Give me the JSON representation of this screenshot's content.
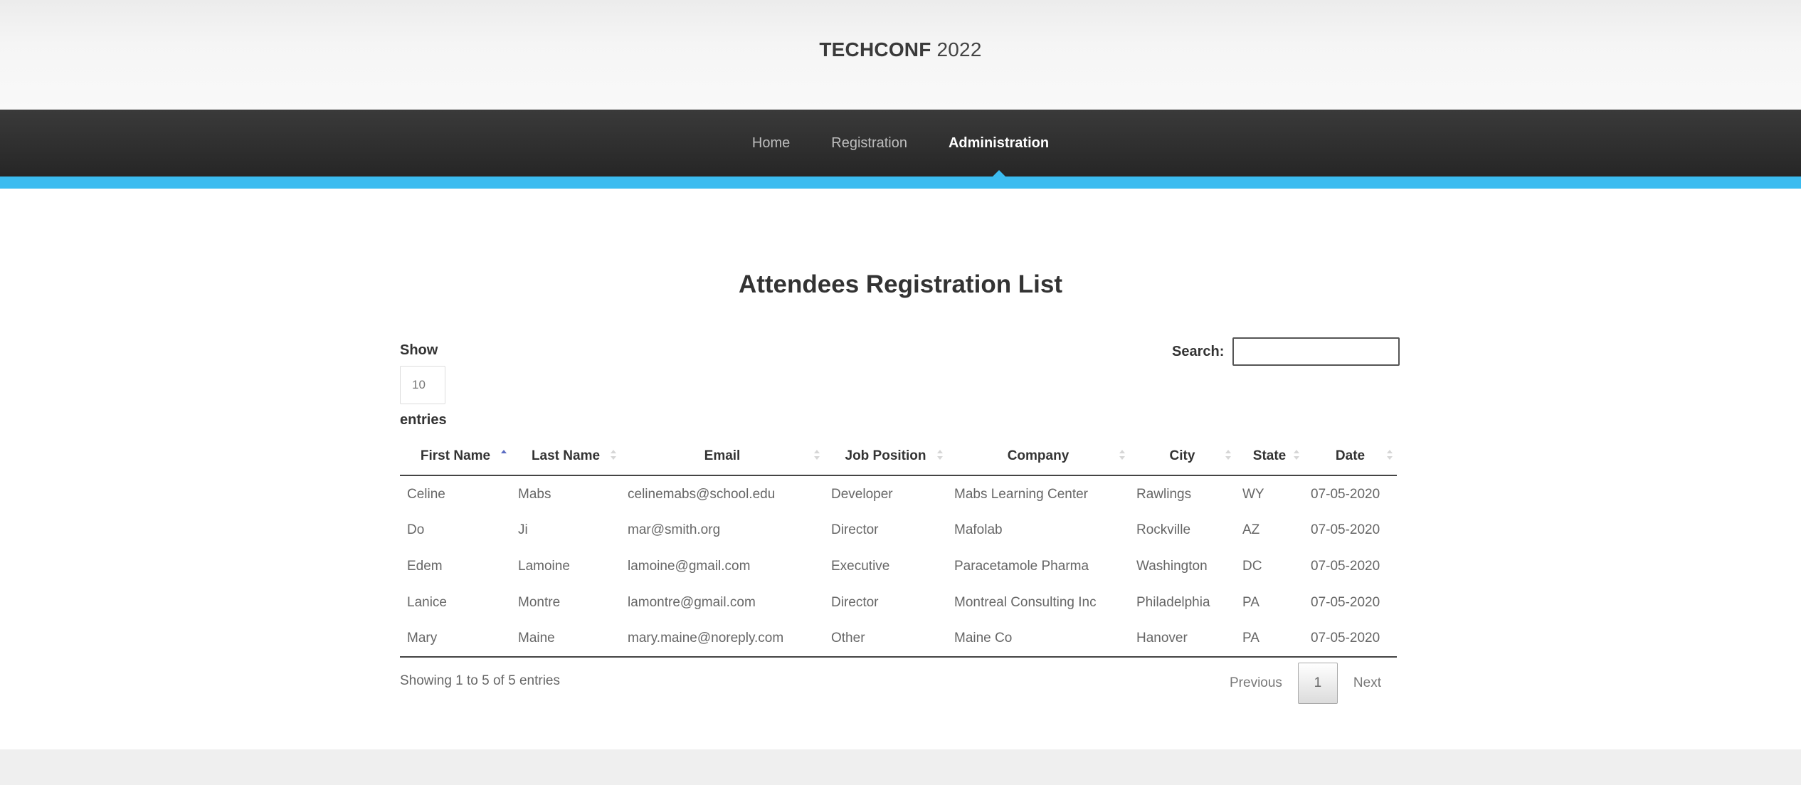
{
  "header": {
    "brand_strong": "TECHCONF",
    "brand_year": "2022"
  },
  "nav": {
    "items": [
      {
        "label": "Home"
      },
      {
        "label": "Registration"
      },
      {
        "label": "Administration",
        "active": true
      }
    ]
  },
  "colors": {
    "accent": "#3bbcf0",
    "navbar": "#2b2b2b"
  },
  "main": {
    "title": "Attendees Registration List",
    "length": {
      "prefix": "Show",
      "value": "10",
      "suffix": "entries"
    },
    "search": {
      "label": "Search:",
      "value": "",
      "placeholder": ""
    },
    "table": {
      "columns": [
        "First Name",
        "Last Name",
        "Email",
        "Job Position",
        "Company",
        "City",
        "State",
        "Date"
      ],
      "sorted_column": "First Name",
      "sort_direction": "ascending",
      "rows": [
        [
          "Celine",
          "Mabs",
          "celinemabs@school.edu",
          "Developer",
          "Mabs Learning Center",
          "Rawlings",
          "WY",
          "07-05-2020"
        ],
        [
          "Do",
          "Ji",
          "mar@smith.org",
          "Director",
          "Mafolab",
          "Rockville",
          "AZ",
          "07-05-2020"
        ],
        [
          "Edem",
          "Lamoine",
          "lamoine@gmail.com",
          "Executive",
          "Paracetamole Pharma",
          "Washington",
          "DC",
          "07-05-2020"
        ],
        [
          "Lanice",
          "Montre",
          "lamontre@gmail.com",
          "Director",
          "Montreal Consulting Inc",
          "Philadelphia",
          "PA",
          "07-05-2020"
        ],
        [
          "Mary",
          "Maine",
          "mary.maine@noreply.com",
          "Other",
          "Maine Co",
          "Hanover",
          "PA",
          "07-05-2020"
        ]
      ]
    },
    "info": "Showing 1 to 5 of 5 entries",
    "pager": {
      "previous": "Previous",
      "current": "1",
      "next": "Next"
    }
  }
}
